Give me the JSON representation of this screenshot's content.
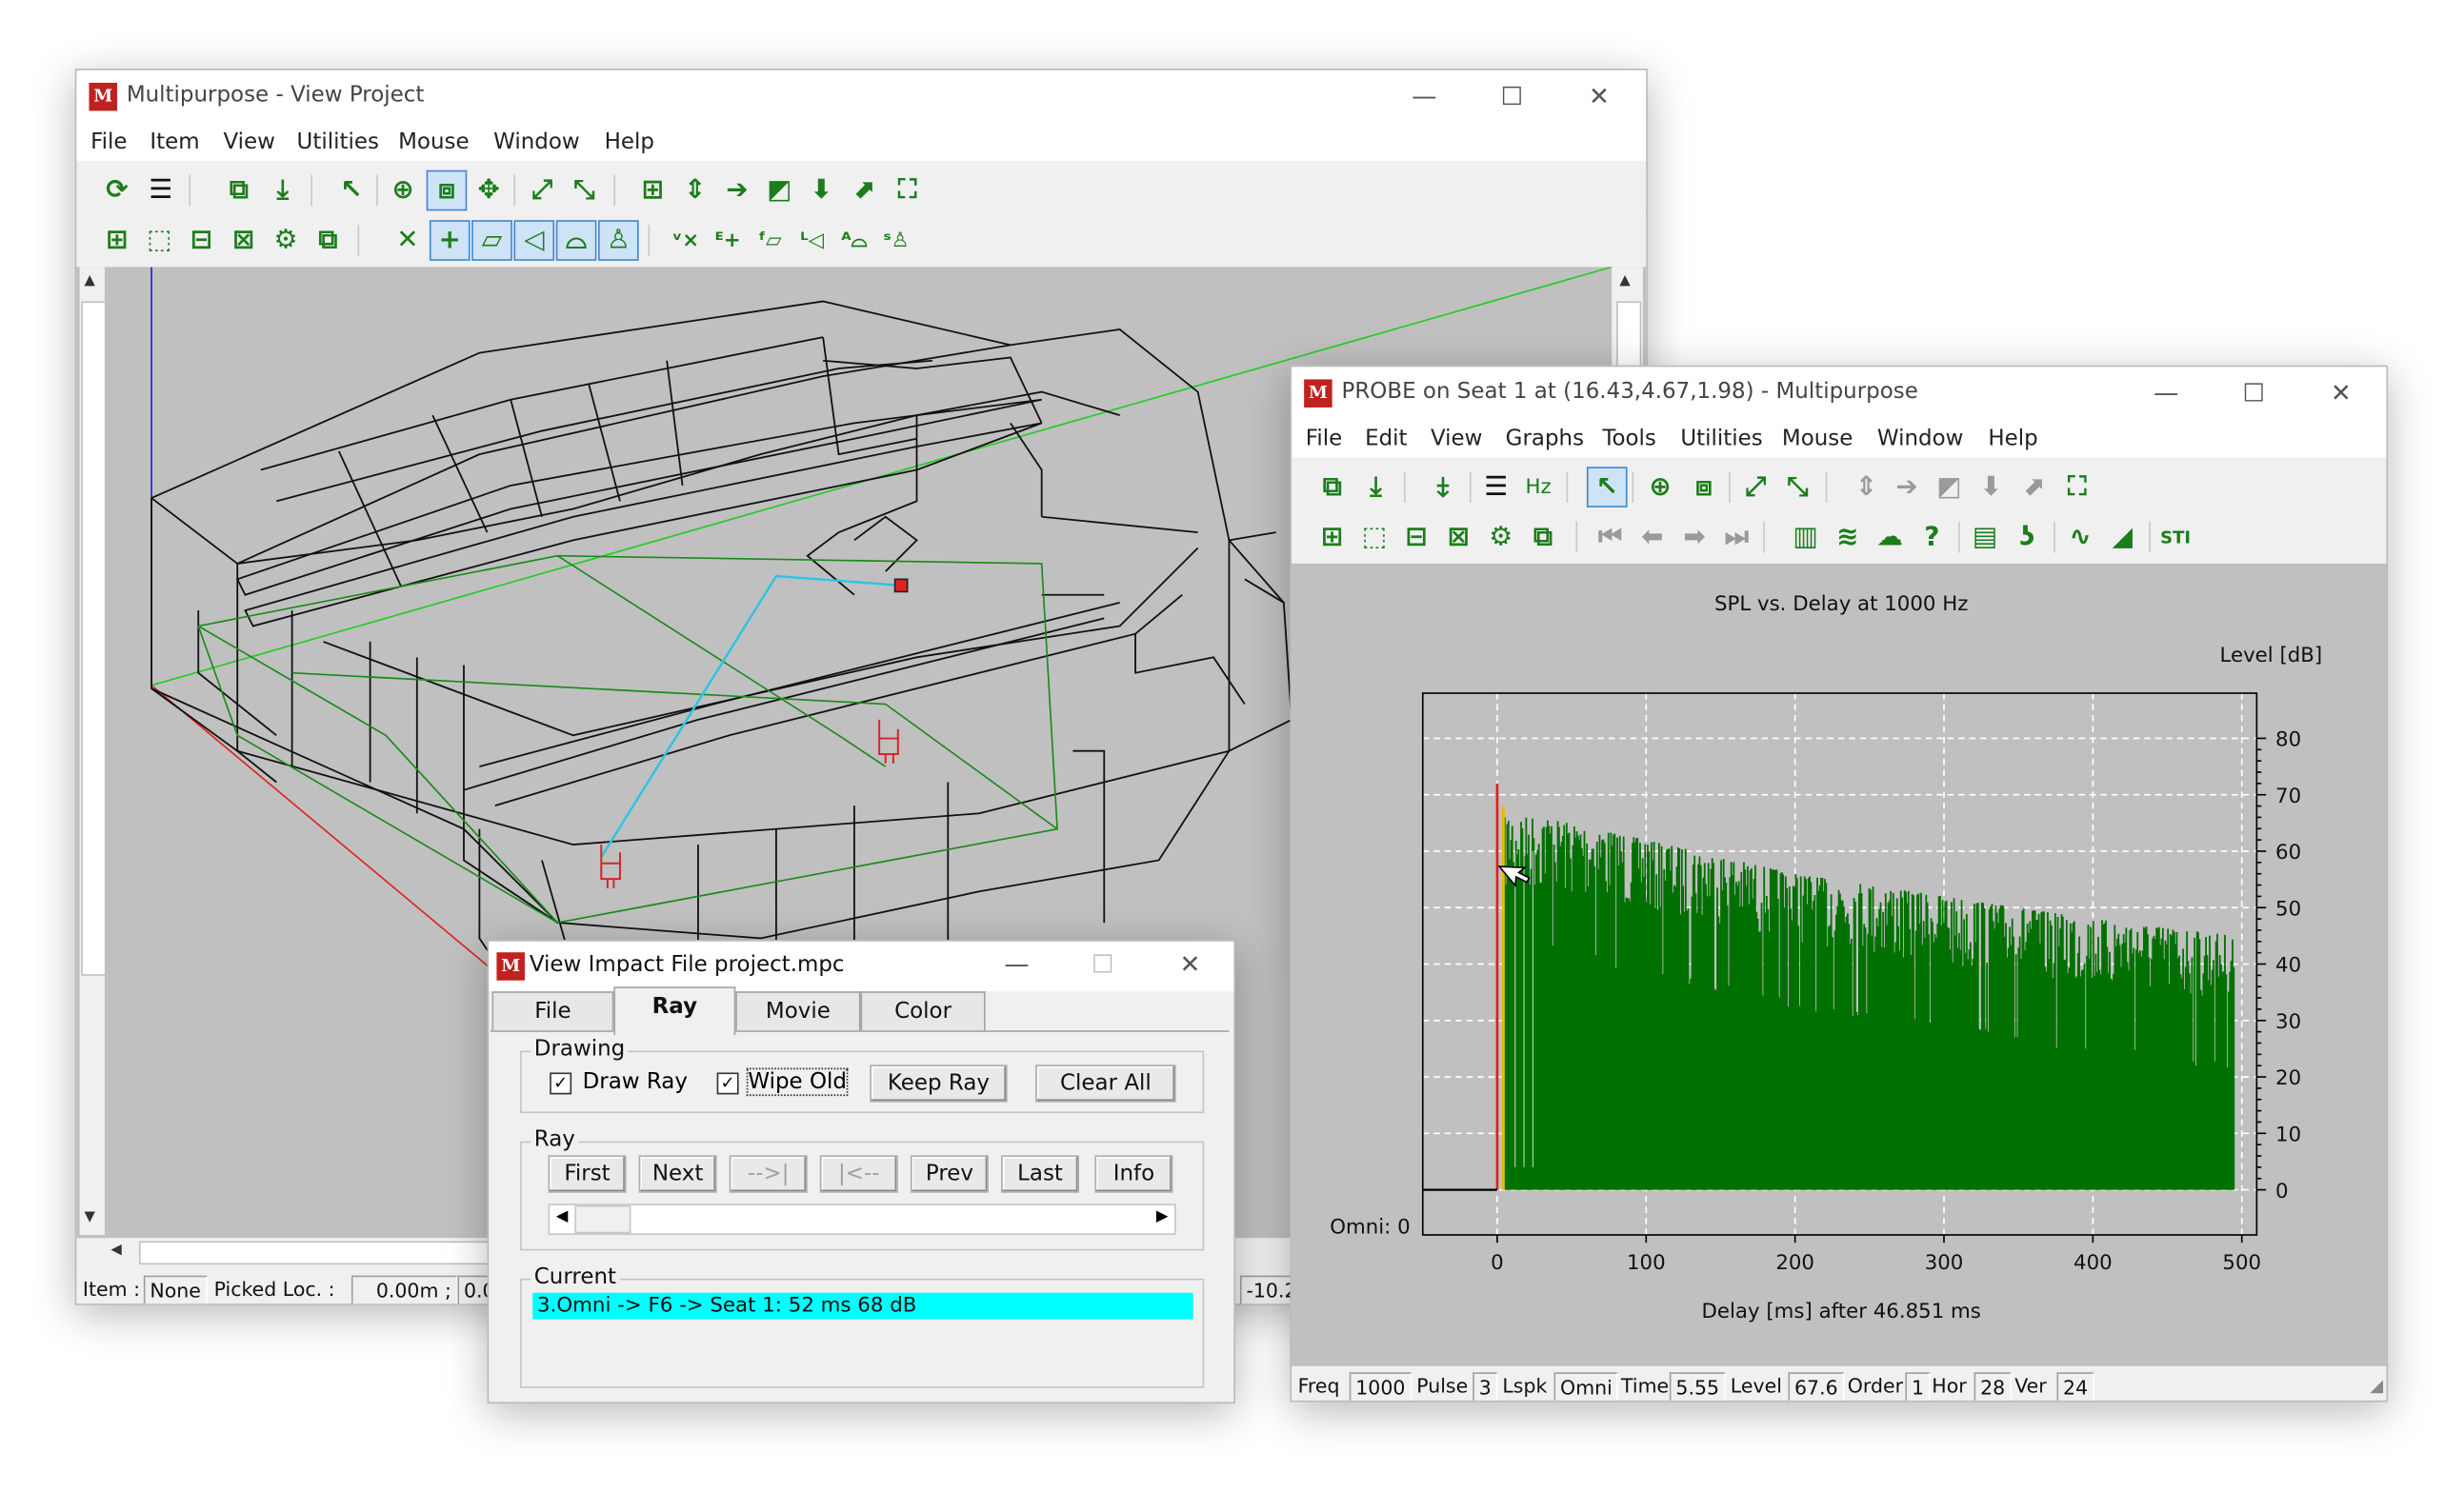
{
  "app_icon_letter": "M",
  "project_window": {
    "title": "Multipurpose - View Project",
    "menus": [
      "File",
      "Item",
      "View",
      "Utilities",
      "Mouse",
      "Window",
      "Help"
    ],
    "status": {
      "item_label": "Item :",
      "item_value": "None",
      "picked_label": "Picked Loc. :",
      "picked_x": "0.00m ;",
      "picked_y": "0.0",
      "right_value": "-10.2"
    }
  },
  "probe_window": {
    "title": "PROBE on Seat 1 at (16.43,4.67,1.98) - Multipurpose",
    "menus": [
      "File",
      "Edit",
      "View",
      "Graphs",
      "Tools",
      "Utilities",
      "Mouse",
      "Window",
      "Help"
    ],
    "hz_button": "Hz",
    "status": [
      {
        "label": "Freq",
        "value": "1000"
      },
      {
        "label": "Pulse",
        "value": "3"
      },
      {
        "label": "Lspk",
        "value": "Omni"
      },
      {
        "label": "Time",
        "value": "5.55"
      },
      {
        "label": "Level",
        "value": "67.6"
      },
      {
        "label": "Order",
        "value": "1"
      },
      {
        "label": "Hor",
        "value": "28"
      },
      {
        "label": "Ver",
        "value": "24"
      }
    ]
  },
  "impact_window": {
    "title": "View Impact File project.mpc",
    "tabs": [
      "File",
      "Ray",
      "Movie",
      "Color"
    ],
    "active_tab": "Ray",
    "drawing_group": "Drawing",
    "draw_ray_label": "Draw Ray",
    "draw_ray_checked": true,
    "wipe_old_label": "Wipe Old",
    "wipe_old_checked": true,
    "keep_ray_button": "Keep Ray",
    "clear_all_button": "Clear All",
    "ray_group": "Ray",
    "ray_buttons": [
      "First",
      "Next",
      "-->|",
      "|<--",
      "Prev",
      "Last",
      "Info"
    ],
    "current_group": "Current",
    "current_item": "3.Omni -> F6 -> Seat 1: 52 ms 68 dB"
  },
  "colors": {
    "bars": "#007000",
    "direct_red": "#e02020",
    "first_yellow": "#e6c000",
    "selection_cyan": "#00ffff",
    "ray_cyan": "#2ec4e6",
    "plot_bg": "#c0c0c0"
  },
  "chart_data": {
    "type": "bar",
    "title": "SPL vs. Delay at  1000 Hz",
    "ylabel": "Level [dB]",
    "xlabel": "Delay [ms] after   46.851 ms",
    "baseline_label": "Omni: 0",
    "xlim": [
      -50,
      510
    ],
    "ylim": [
      -8,
      88
    ],
    "x_ticks": [
      0,
      100,
      200,
      300,
      400,
      500
    ],
    "y_ticks": [
      0,
      10,
      20,
      30,
      40,
      50,
      60,
      70,
      80
    ],
    "grid": true,
    "direct": {
      "x": 0,
      "y": 72
    },
    "first_reflection": {
      "x": 4,
      "y": 68
    },
    "envelope": [
      [
        5,
        66
      ],
      [
        30,
        66
      ],
      [
        100,
        62
      ],
      [
        200,
        56
      ],
      [
        300,
        52
      ],
      [
        400,
        48
      ],
      [
        495,
        45
      ]
    ]
  }
}
